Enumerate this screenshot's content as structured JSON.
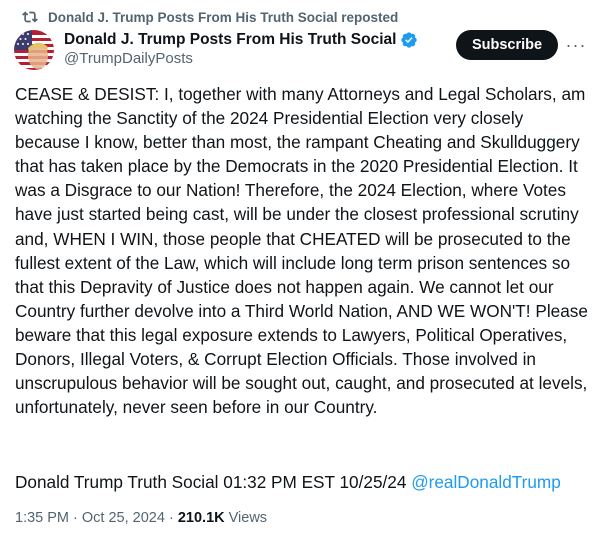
{
  "repost": {
    "icon": "repost-icon",
    "text": "Donald J. Trump Posts From His Truth Social reposted"
  },
  "author": {
    "display_name": "Donald J. Trump Posts From His Truth Social",
    "handle": "@TrumpDailyPosts",
    "verified_icon": "verified-badge-icon",
    "verified_color": "#1d9bf0"
  },
  "actions": {
    "subscribe_label": "Subscribe",
    "more_icon": "more-options-icon",
    "more_glyph": "···"
  },
  "post": {
    "body": "CEASE & DESIST: I, together with many Attorneys and Legal Scholars, am watching the Sanctity of the 2024 Presidential Election very closely because I know, better than most, the rampant Cheating and Skullduggery that has taken place by the Democrats in the 2020 Presidential Election. It was a Disgrace to our Nation! Therefore, the 2024 Election, where Votes have just started being cast, will be under the closest professional scrutiny and, WHEN I WIN, those people that CHEATED will be prosecuted to the fullest extent of the Law, which will include long term prison sentences so that this Depravity of Justice does not happen again. We cannot let our Country further devolve into a Third World Nation, AND WE WON'T! Please beware that this legal exposure extends to Lawyers, Political Operatives, Donors, Illegal Voters, & Corrupt Election Officials. Those involved in unscrupulous behavior will be sought out, caught, and prosecuted at levels, unfortunately, never seen before in our Country.",
    "source_line": "Donald Trump Truth Social 01:32 PM EST 10/25/24",
    "mention": "@realDonaldTrump",
    "mention_color": "#1d9bf0"
  },
  "meta": {
    "time": "1:35 PM",
    "separator": "·",
    "date": "Oct 25, 2024",
    "views_count": "210.1K",
    "views_label": "Views"
  }
}
